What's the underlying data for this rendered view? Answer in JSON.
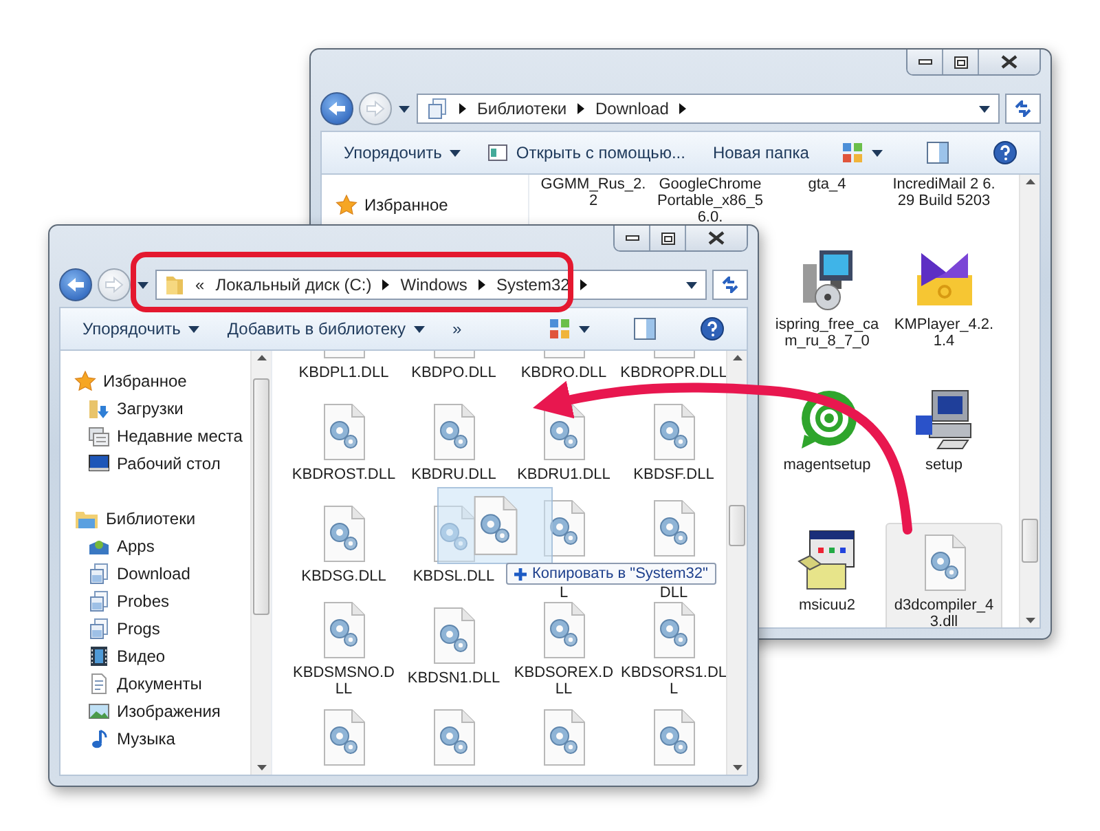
{
  "back_window": {
    "address": {
      "segments": [
        "Библиотеки",
        "Download"
      ]
    },
    "toolbar": [
      {
        "label": "Упорядочить",
        "kind": "menu"
      },
      {
        "label": "Открыть с помощью...",
        "kind": "icon"
      },
      {
        "label": "Новая папка",
        "kind": "plain"
      }
    ],
    "sidebar": [
      {
        "label": "Избранное",
        "kind": "star"
      }
    ],
    "files": [
      {
        "name": "GGMM_Rus_2.2",
        "kind": "label_only",
        "selected": false
      },
      {
        "name": "GoogleChromePortable_x86_56.0.",
        "kind": "label_only",
        "selected": false
      },
      {
        "name": "gta_4",
        "kind": "label_only",
        "selected": false
      },
      {
        "name": "IncrediMail 2 6.29 Build 5203",
        "kind": "label_only",
        "selected": false
      },
      {
        "name": "ispring_free_cam_ru_8_7_0",
        "kind": "installer",
        "selected": false
      },
      {
        "name": "KMPlayer_4.2.1.4",
        "kind": "media",
        "selected": false
      },
      {
        "name": "magentsetup",
        "kind": "chat",
        "selected": false
      },
      {
        "name": "setup",
        "kind": "computer",
        "selected": false
      },
      {
        "name": "msicuu2",
        "kind": "package",
        "selected": false
      },
      {
        "name": "d3dcompiler_43.dll",
        "kind": "dll",
        "selected": true
      }
    ]
  },
  "front_window": {
    "address": {
      "overflow": "«",
      "segments": [
        "Локальный диск (C:)",
        "Windows",
        "System32"
      ]
    },
    "toolbar": [
      {
        "label": "Упорядочить",
        "kind": "menu"
      },
      {
        "label": "Добавить в библиотеку",
        "kind": "menu"
      },
      {
        "label": "»",
        "kind": "plain"
      }
    ],
    "sidebar": [
      {
        "label": "Избранное",
        "kind": "star",
        "children": [
          {
            "label": "Загрузки",
            "kind": "downloads"
          },
          {
            "label": "Недавние места",
            "kind": "recent"
          },
          {
            "label": "Рабочий стол",
            "kind": "desktop"
          }
        ]
      },
      {
        "label": "Библиотеки",
        "kind": "libraries",
        "children": [
          {
            "label": "Apps",
            "kind": "apps"
          },
          {
            "label": "Download",
            "kind": "library"
          },
          {
            "label": "Probes",
            "kind": "library"
          },
          {
            "label": "Progs",
            "kind": "library"
          },
          {
            "label": "Видео",
            "kind": "video"
          },
          {
            "label": "Документы",
            "kind": "documents"
          },
          {
            "label": "Изображения",
            "kind": "pictures"
          },
          {
            "label": "Музыка",
            "kind": "music"
          }
        ]
      }
    ],
    "files": [
      {
        "name": "KBDPL1.DLL",
        "kind": "dll",
        "selected": false
      },
      {
        "name": "KBDPO.DLL",
        "kind": "dll",
        "selected": false
      },
      {
        "name": "KBDRO.DLL",
        "kind": "dll",
        "selected": false
      },
      {
        "name": "KBDROPR.DLL",
        "kind": "dll",
        "selected": false
      },
      {
        "name": "KBDROST.DLL",
        "kind": "dll",
        "selected": false
      },
      {
        "name": "KBDRU.DLL",
        "kind": "dll",
        "selected": false
      },
      {
        "name": "KBDRU1.DLL",
        "kind": "dll",
        "selected": false
      },
      {
        "name": "KBDSF.DLL",
        "kind": "dll",
        "selected": false
      },
      {
        "name": "KBDSG.DLL",
        "kind": "dll",
        "selected": false
      },
      {
        "name": "KBDSL.DLL",
        "kind": "dll",
        "selected": false
      },
      {
        "name": "L",
        "kind": "dll_covered",
        "selected": false
      },
      {
        "name": "DLL",
        "kind": "dll_covered",
        "selected": false
      },
      {
        "name": "KBDSMSNO.DLL",
        "kind": "dll",
        "selected": false
      },
      {
        "name": "KBDSN1.DLL",
        "kind": "dll",
        "selected": false
      },
      {
        "name": "KBDSOREX.DLL",
        "kind": "dll",
        "selected": false
      },
      {
        "name": "KBDSORS1.DLL",
        "kind": "dll",
        "selected": false
      },
      {
        "kind": "dll",
        "selected": false
      },
      {
        "kind": "dll",
        "selected": false
      },
      {
        "kind": "dll",
        "selected": false
      },
      {
        "kind": "dll",
        "selected": false
      }
    ]
  },
  "drag": {
    "tooltip": "Копировать в \"System32\""
  }
}
